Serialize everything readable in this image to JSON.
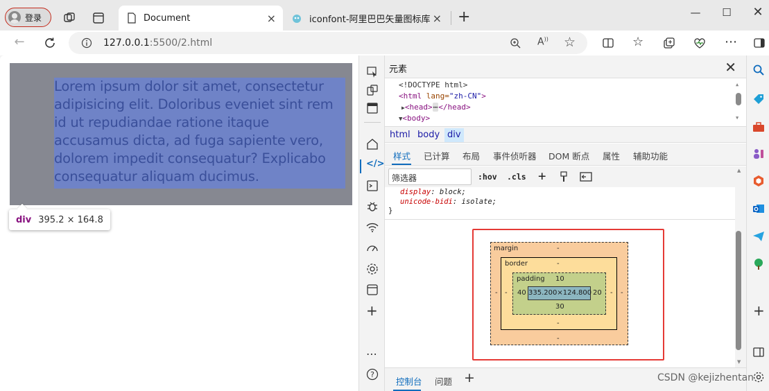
{
  "browser": {
    "profile_label": "登录",
    "tabs": [
      {
        "title": "Document",
        "active": true
      },
      {
        "title": "iconfont-阿里巴巴矢量图标库",
        "active": false
      }
    ],
    "new_tab_symbol": "+",
    "address": {
      "host": "127.0.0.1",
      "path": ":5500/2.html"
    }
  },
  "page": {
    "demo_text": "Lorem ipsum dolor sit amet, consectetur adipisicing elit. Doloribus eveniet sint rem id ut repudiandae ratione itaque accusamus dicta, ad fuga sapiente vero, dolorem impedit consequatur? Explicabo consequatur aliquam ducimus.",
    "tooltip": {
      "tag": "div",
      "size": "395.2 × 164.8"
    }
  },
  "devtools": {
    "panel_title": "元素",
    "dom_tree": {
      "doctype": "<!DOCTYPE html>",
      "html_open": "<html",
      "html_attr": " lang=",
      "html_val": "\"zh-CN\"",
      "html_close": ">",
      "head_open": "<head>",
      "ellipsis": "⋯",
      "head_close": "</head>",
      "body_open": "<body>"
    },
    "breadcrumbs": [
      "html",
      "body",
      "div"
    ],
    "subtabs": [
      "样式",
      "已计算",
      "布局",
      "事件侦听器",
      "DOM 断点",
      "属性",
      "辅助功能"
    ],
    "filter_placeholder": "筛选器",
    "filter_buttons": [
      ":hov",
      ".cls",
      "+"
    ],
    "styles": {
      "prop1": "display",
      "val1": ": block;",
      "prop2": "unicode-bidi",
      "val2": ": isolate;",
      "brace": "}"
    },
    "box_model": {
      "margin_label": "margin",
      "border_label": "border",
      "padding_label": "padding",
      "margin": {
        "top": "-",
        "right": "-",
        "bottom": "-",
        "left": "-"
      },
      "border": {
        "top": "-",
        "right": "-",
        "bottom": "-",
        "left": "-"
      },
      "padding": {
        "top": "10",
        "right": "20",
        "bottom": "30",
        "left": "40"
      },
      "content": "335.200×124.800"
    },
    "drawer_tabs": [
      "控制台",
      "问题"
    ],
    "drawer_add": "+"
  },
  "watermark": "CSDN @kejizhentan",
  "colors": {
    "accent": "#0f6cbd",
    "highlight": "#e53935",
    "margin": "#f9cc9d",
    "border": "#fddd9b",
    "padding": "#c3d08b",
    "content": "#8cb6c0"
  }
}
